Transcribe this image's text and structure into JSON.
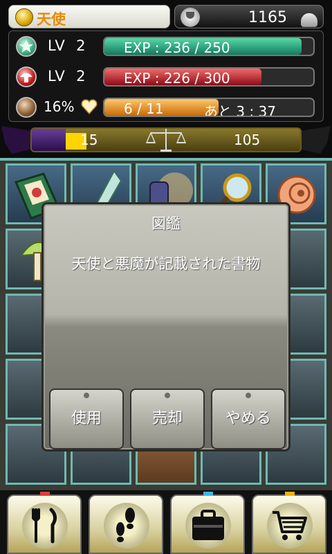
{
  "header": {
    "player_name": "天使",
    "money": "1165"
  },
  "stats": {
    "angel": {
      "lv_label": "LV",
      "lv": "2",
      "exp_text": "EXP : 236 / 250",
      "exp_fraction": 0.944
    },
    "devil": {
      "lv_label": "LV",
      "lv": "2",
      "exp_text": "EXP : 226 / 300",
      "exp_fraction": 0.753
    },
    "mood": {
      "percent": "16%",
      "stamina_text": "6 / 11",
      "timer_text": "あと 3 : 37",
      "stamina_fraction": 0.545
    }
  },
  "balance": {
    "dark_value": "15",
    "light_value": "105",
    "dark_fraction": 0.125
  },
  "colors": {
    "accent_teal": "#6fb9b3",
    "name_orange": "#e98a00",
    "exp_green": "#137a5e",
    "exp_red": "#8a0d18",
    "stamina_orange": "#c86a08"
  },
  "dialog": {
    "title": "図鑑",
    "description": "天使と悪魔が記載された書物",
    "buttons": {
      "use": "使用",
      "sell": "売却",
      "cancel": "やめる"
    }
  },
  "grid_items": [
    "book-icon",
    "crystal-icon",
    "hammer-icon",
    "magnifier-icon",
    "snail-shell-icon",
    "mushroom-icon"
  ],
  "nav": {
    "icons": [
      "fork-knife-icon",
      "footprints-icon",
      "bag-icon",
      "cart-icon"
    ]
  }
}
